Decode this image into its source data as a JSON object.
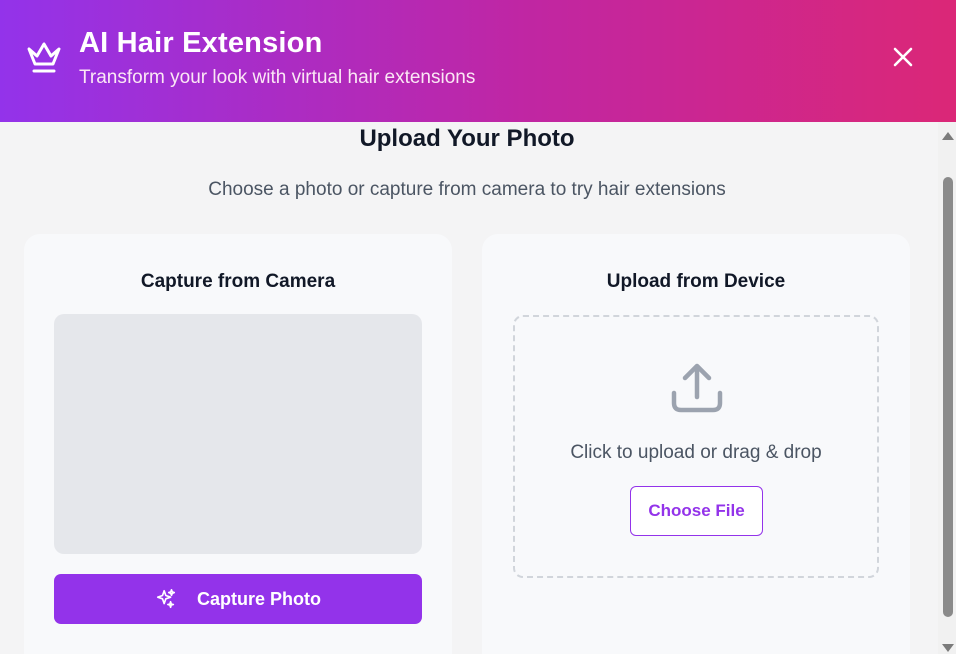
{
  "header": {
    "title": "AI Hair Extension",
    "subtitle": "Transform your look with virtual hair extensions",
    "icon": "crown-icon",
    "close_icon": "close-icon",
    "gradient": [
      "#9333ea",
      "#c026a3",
      "#db2777"
    ]
  },
  "main": {
    "title": "Upload Your Photo",
    "subtitle": "Choose a photo or capture from camera to try hair extensions"
  },
  "camera_card": {
    "title": "Capture from Camera",
    "button_label": "Capture Photo",
    "button_icon": "sparkles-icon",
    "accent": "#9333ea"
  },
  "upload_card": {
    "title": "Upload from Device",
    "icon": "upload-icon",
    "drop_text": "Click to upload or drag & drop",
    "button_label": "Choose File"
  }
}
